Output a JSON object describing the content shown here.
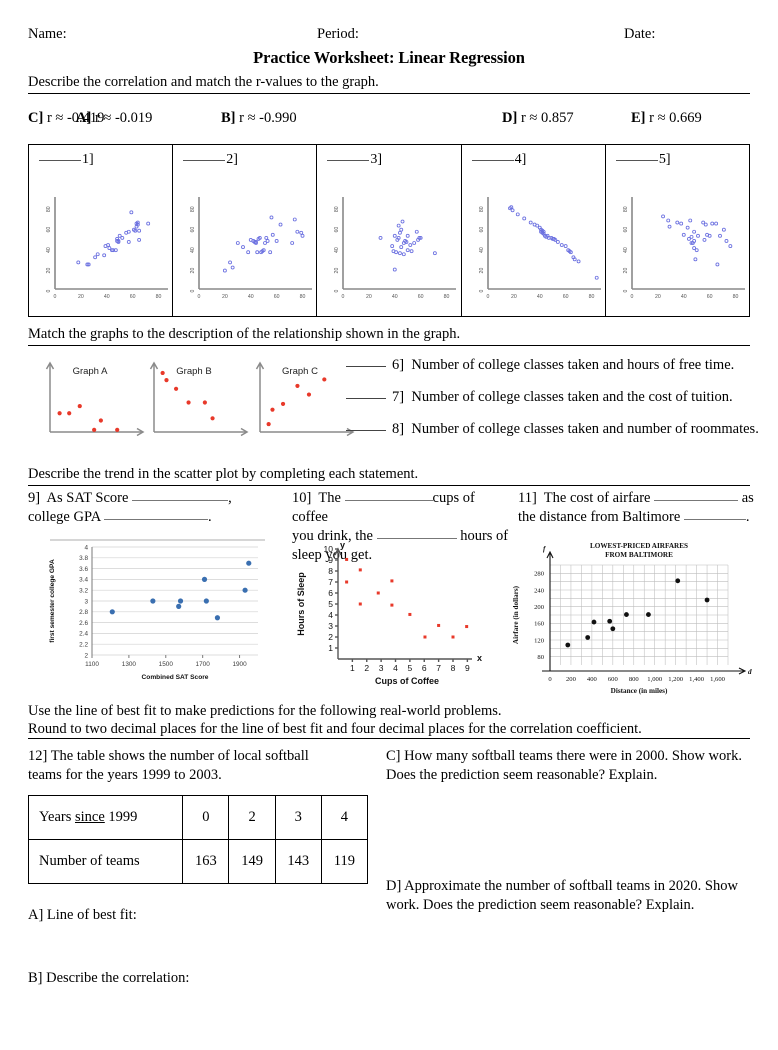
{
  "header": {
    "name_label": "Name:",
    "period_label": "Period:",
    "date_label": "Date:",
    "title": "Practice Worksheet: Linear Regression"
  },
  "section1": {
    "instruction": "Describe the correlation and match the r-values to the graph.",
    "r_values": [
      {
        "letter": "A]",
        "value": "r ≈ -0.019"
      },
      {
        "letter": "B]",
        "value": "r ≈ -0.990"
      },
      {
        "letter": "C]",
        "value": "r ≈ -0.419"
      },
      {
        "letter": "D]",
        "value": "r ≈ 0.857"
      },
      {
        "letter": "E]",
        "value": "r ≈ 0.669"
      }
    ],
    "panel_labels": [
      "1]",
      "2]",
      "3]",
      "4]",
      "5]"
    ]
  },
  "section2": {
    "instruction": "Match the graphs to the description of the relationship shown in the graph.",
    "graph_titles": [
      "Graph A",
      "Graph B",
      "Graph C"
    ],
    "questions": [
      {
        "num": "6]",
        "text": "Number of college classes taken and hours of free time."
      },
      {
        "num": "7]",
        "text": "Number of college classes taken and the cost of tuition."
      },
      {
        "num": "8]",
        "text": "Number of college classes taken and number of roommates."
      }
    ]
  },
  "section3": {
    "instruction": "Describe the trend in the scatter plot by completing each statement.",
    "q9": {
      "num": "9]",
      "part1": "As SAT Score",
      "part2": ",",
      "part3": "college GPA",
      "part4": "."
    },
    "q10": {
      "num": "10]",
      "part1": "The",
      "part2": "cups of coffee",
      "part3": "you drink, the",
      "part4": "hours of",
      "part5": "sleep you get."
    },
    "q11": {
      "num": "11]",
      "part1": "The cost of airfare",
      "part2": "as",
      "part3": "the distance from Baltimore",
      "part4": "."
    }
  },
  "section4": {
    "line1": "Use the line of best fit to make predictions for the following real-world problems.",
    "line2": "Round to two decimal places for the line of best fit and four decimal places for the correlation coefficient."
  },
  "section5": {
    "q12_line1": "12]  The table shows the number of local softball",
    "q12_line2_a": "teams for the years 1999 to 2003.",
    "table": {
      "row1_header_pre": "Years ",
      "row1_header_mid": "since",
      "row1_header_post": " 1999",
      "row1_values": [
        "0",
        "2",
        "3",
        "4"
      ],
      "row2_header": "Number of teams",
      "row2_values": [
        "163",
        "149",
        "143",
        "119"
      ]
    },
    "partA": "A]  Line of best fit:",
    "partB": "B]  Describe the correlation:",
    "partC_line1": "C]  How many softball teams there were in 2000.  Show work.",
    "partC_line2": "Does the prediction seem reasonable?  Explain.",
    "partD_line1": "D]  Approximate the number of softball teams in 2020.  Show",
    "partD_line2": "work. Does the prediction seem reasonable?  Explain."
  },
  "colors": {
    "scatter_blue": "#6b70e0",
    "mini_red": "#e8392a",
    "sat_blue": "#3a6fb0",
    "coffee_red": "#e8392a",
    "airfare_black": "#111111"
  },
  "chart_data": [
    {
      "id": "scatter1",
      "type": "scatter",
      "title": "1]",
      "xlabel": "",
      "ylabel": "",
      "xlim": [
        0,
        85
      ],
      "ylim": [
        0,
        90
      ],
      "xticks": [
        0,
        20,
        40,
        60,
        80
      ],
      "yticks": [
        0,
        20,
        40,
        60,
        80
      ],
      "correlation": 0.857,
      "grid": false,
      "points": [
        [
          18,
          26
        ],
        [
          25,
          24
        ],
        [
          26,
          24
        ],
        [
          31,
          31
        ],
        [
          33,
          34
        ],
        [
          38,
          33
        ],
        [
          39,
          42
        ],
        [
          41,
          43
        ],
        [
          42,
          40
        ],
        [
          44,
          38
        ],
        [
          45,
          38
        ],
        [
          47,
          38
        ],
        [
          48,
          47
        ],
        [
          48,
          49
        ],
        [
          49,
          46
        ],
        [
          49,
          47
        ],
        [
          50,
          52
        ],
        [
          52,
          50
        ],
        [
          55,
          55
        ],
        [
          57,
          56
        ],
        [
          57,
          46
        ],
        [
          59,
          75
        ],
        [
          61,
          58
        ],
        [
          62,
          57
        ],
        [
          63,
          61
        ],
        [
          63,
          64
        ],
        [
          64,
          63
        ],
        [
          64,
          65
        ],
        [
          65,
          48
        ],
        [
          65,
          57
        ],
        [
          72,
          64
        ]
      ]
    },
    {
      "id": "scatter2",
      "type": "scatter",
      "title": "2]",
      "xlabel": "",
      "ylabel": "",
      "xlim": [
        0,
        85
      ],
      "ylim": [
        0,
        90
      ],
      "xticks": [
        0,
        20,
        40,
        60,
        80
      ],
      "yticks": [
        0,
        20,
        40,
        60,
        80
      ],
      "correlation": 0.419,
      "grid": false,
      "points": [
        [
          20,
          18
        ],
        [
          24,
          26
        ],
        [
          26,
          21
        ],
        [
          30,
          45
        ],
        [
          34,
          41
        ],
        [
          38,
          36
        ],
        [
          40,
          48
        ],
        [
          42,
          47
        ],
        [
          43,
          46
        ],
        [
          44,
          46
        ],
        [
          44,
          45
        ],
        [
          45,
          36
        ],
        [
          46,
          49
        ],
        [
          47,
          50
        ],
        [
          48,
          36
        ],
        [
          49,
          37
        ],
        [
          50,
          38
        ],
        [
          51,
          45
        ],
        [
          52,
          50
        ],
        [
          53,
          47
        ],
        [
          55,
          36
        ],
        [
          56,
          70
        ],
        [
          57,
          53
        ],
        [
          60,
          47
        ],
        [
          63,
          63
        ],
        [
          72,
          45
        ],
        [
          74,
          68
        ],
        [
          76,
          56
        ],
        [
          79,
          55
        ],
        [
          80,
          52
        ]
      ]
    },
    {
      "id": "scatter3",
      "type": "scatter",
      "title": "3]",
      "xlabel": "",
      "ylabel": "",
      "xlim": [
        0,
        85
      ],
      "ylim": [
        0,
        90
      ],
      "xticks": [
        0,
        20,
        40,
        60,
        80
      ],
      "yticks": [
        0,
        20,
        40,
        60,
        80
      ],
      "correlation": -0.019,
      "grid": false,
      "points": [
        [
          29,
          50
        ],
        [
          38,
          42
        ],
        [
          39,
          37
        ],
        [
          40,
          19
        ],
        [
          40,
          52
        ],
        [
          41,
          36
        ],
        [
          42,
          48
        ],
        [
          43,
          50
        ],
        [
          43,
          62
        ],
        [
          44,
          35
        ],
        [
          44,
          55
        ],
        [
          45,
          41
        ],
        [
          45,
          58
        ],
        [
          46,
          66
        ],
        [
          47,
          45
        ],
        [
          47,
          34
        ],
        [
          48,
          47
        ],
        [
          49,
          46
        ],
        [
          50,
          38
        ],
        [
          50,
          52
        ],
        [
          52,
          43
        ],
        [
          53,
          37
        ],
        [
          55,
          45
        ],
        [
          57,
          56
        ],
        [
          58,
          48
        ],
        [
          59,
          50
        ],
        [
          60,
          50
        ],
        [
          71,
          35
        ]
      ]
    },
    {
      "id": "scatter4",
      "type": "scatter",
      "title": "4]",
      "xlabel": "",
      "ylabel": "",
      "xlim": [
        0,
        85
      ],
      "ylim": [
        0,
        90
      ],
      "xticks": [
        0,
        20,
        40,
        60,
        80
      ],
      "yticks": [
        0,
        20,
        40,
        60,
        80
      ],
      "correlation": -0.99,
      "grid": false,
      "points": [
        [
          17,
          79
        ],
        [
          18,
          80
        ],
        [
          19,
          77
        ],
        [
          23,
          73
        ],
        [
          28,
          69
        ],
        [
          33,
          65
        ],
        [
          36,
          63
        ],
        [
          38,
          62
        ],
        [
          40,
          60
        ],
        [
          41,
          58
        ],
        [
          41,
          56
        ],
        [
          42,
          57
        ],
        [
          42,
          55
        ],
        [
          43,
          54
        ],
        [
          43,
          56
        ],
        [
          44,
          52
        ],
        [
          45,
          51
        ],
        [
          46,
          52
        ],
        [
          47,
          50
        ],
        [
          49,
          50
        ],
        [
          50,
          49
        ],
        [
          51,
          49
        ],
        [
          52,
          48
        ],
        [
          54,
          46
        ],
        [
          57,
          43
        ],
        [
          60,
          42
        ],
        [
          62,
          38
        ],
        [
          63,
          37
        ],
        [
          64,
          36
        ],
        [
          66,
          31
        ],
        [
          67,
          29
        ],
        [
          70,
          27
        ],
        [
          84,
          11
        ]
      ]
    },
    {
      "id": "scatter5",
      "type": "scatter",
      "title": "5]",
      "xlabel": "",
      "ylabel": "",
      "xlim": [
        0,
        85
      ],
      "ylim": [
        0,
        90
      ],
      "xticks": [
        0,
        20,
        40,
        60,
        80
      ],
      "yticks": [
        0,
        20,
        40,
        60,
        80
      ],
      "correlation": 0.669,
      "grid": false,
      "points": [
        [
          24,
          71
        ],
        [
          28,
          67
        ],
        [
          29,
          61
        ],
        [
          35,
          65
        ],
        [
          38,
          64
        ],
        [
          40,
          53
        ],
        [
          43,
          60
        ],
        [
          44,
          49
        ],
        [
          45,
          67
        ],
        [
          46,
          51
        ],
        [
          46,
          45
        ],
        [
          47,
          45
        ],
        [
          48,
          47
        ],
        [
          48,
          56
        ],
        [
          48,
          40
        ],
        [
          49,
          29
        ],
        [
          50,
          38
        ],
        [
          51,
          52
        ],
        [
          55,
          65
        ],
        [
          56,
          48
        ],
        [
          57,
          63
        ],
        [
          58,
          53
        ],
        [
          60,
          52
        ],
        [
          62,
          64
        ],
        [
          65,
          64
        ],
        [
          66,
          24
        ],
        [
          68,
          52
        ],
        [
          71,
          58
        ],
        [
          73,
          47
        ],
        [
          76,
          42
        ]
      ]
    },
    {
      "id": "graphA",
      "type": "scatter",
      "title": "Graph A",
      "xlabel": "",
      "ylabel": "",
      "xlim": [
        0,
        10
      ],
      "ylim": [
        0,
        10
      ],
      "grid": false,
      "points": [
        [
          1.0,
          2.6
        ],
        [
          2.0,
          2.6
        ],
        [
          3.1,
          3.6
        ],
        [
          5.3,
          1.6
        ],
        [
          4.6,
          0.3
        ],
        [
          7.0,
          0.3
        ]
      ]
    },
    {
      "id": "graphB",
      "type": "scatter",
      "title": "Graph B",
      "xlabel": "",
      "ylabel": "",
      "xlim": [
        0,
        10
      ],
      "ylim": [
        0,
        10
      ],
      "grid": false,
      "points": [
        [
          0.9,
          8.2
        ],
        [
          1.3,
          7.2
        ],
        [
          2.3,
          6.0
        ],
        [
          3.6,
          4.1
        ],
        [
          5.3,
          4.1
        ],
        [
          6.1,
          1.9
        ]
      ]
    },
    {
      "id": "graphC",
      "type": "scatter",
      "title": "Graph C",
      "xlabel": "",
      "ylabel": "",
      "xlim": [
        0,
        10
      ],
      "ylim": [
        0,
        10
      ],
      "grid": false,
      "points": [
        [
          0.9,
          1.1
        ],
        [
          1.3,
          3.1
        ],
        [
          2.4,
          3.9
        ],
        [
          3.9,
          6.4
        ],
        [
          5.1,
          5.2
        ],
        [
          6.7,
          7.3
        ]
      ]
    },
    {
      "id": "sat_gpa",
      "type": "scatter",
      "title": "",
      "xlabel": "Combined SAT Score",
      "ylabel": "first semester college GPA",
      "xlim": [
        1100,
        2000
      ],
      "ylim": [
        2,
        4
      ],
      "xticks": [
        1100,
        1300,
        1500,
        1700,
        1900
      ],
      "yticks": [
        2,
        2.2,
        2.4,
        2.6,
        2.8,
        3,
        3.2,
        3.4,
        3.6,
        3.8,
        4
      ],
      "grid": true,
      "points": [
        [
          1210,
          2.8
        ],
        [
          1430,
          3.0
        ],
        [
          1570,
          2.9
        ],
        [
          1580,
          3.0
        ],
        [
          1710,
          3.4
        ],
        [
          1720,
          3.0
        ],
        [
          1780,
          2.69
        ],
        [
          1930,
          3.2
        ],
        [
          1950,
          3.7
        ]
      ]
    },
    {
      "id": "coffee_sleep",
      "type": "scatter",
      "title": "",
      "xlabel": "Cups of Coffee",
      "ylabel": "Hours of Sleep",
      "xlim": [
        0,
        9.6
      ],
      "ylim": [
        0,
        10
      ],
      "xticks": [
        1,
        2,
        3,
        4,
        5,
        6,
        7,
        8,
        9
      ],
      "yticks": [
        1,
        2,
        3,
        4,
        5,
        6,
        7,
        8,
        9,
        10
      ],
      "axis_labels": {
        "x_axis_letter": "x",
        "y_axis_letter": "y"
      },
      "grid": false,
      "points": [
        [
          0.6,
          9.05
        ],
        [
          0.6,
          7.0
        ],
        [
          1.55,
          8.1
        ],
        [
          1.55,
          5.0
        ],
        [
          2.8,
          6.0
        ],
        [
          3.75,
          7.1
        ],
        [
          3.75,
          4.9
        ],
        [
          5.0,
          4.05
        ],
        [
          6.05,
          2.0
        ],
        [
          7.0,
          3.05
        ],
        [
          8.0,
          2.0
        ],
        [
          8.95,
          2.95
        ]
      ]
    },
    {
      "id": "airfare",
      "type": "scatter",
      "title": "LOWEST-PRICED AIRFARES FROM BALTIMORE",
      "title_line1": "LOWEST-PRICED AIRFARES",
      "title_line2": "FROM BALTIMORE",
      "xlabel": "Distance (in miles)",
      "ylabel": "Airfare (in dollars)",
      "xlim": [
        0,
        1700
      ],
      "ylim": [
        60,
        300
      ],
      "xticks": [
        0,
        200,
        400,
        600,
        800,
        1000,
        1200,
        1400,
        1600
      ],
      "xticklabels": [
        "0",
        "200",
        "400",
        "600",
        "800",
        "1,000",
        "1,200",
        "1,400",
        "1,600"
      ],
      "yticks": [
        80,
        120,
        160,
        200,
        240,
        280
      ],
      "axis_labels": {
        "x_axis_letter": "d",
        "y_axis_letter": "f"
      },
      "grid": true,
      "points": [
        [
          170,
          108
        ],
        [
          360,
          126
        ],
        [
          420,
          163
        ],
        [
          570,
          165
        ],
        [
          600,
          147
        ],
        [
          730,
          181
        ],
        [
          940,
          181
        ],
        [
          1220,
          262
        ],
        [
          1500,
          216
        ]
      ]
    }
  ]
}
